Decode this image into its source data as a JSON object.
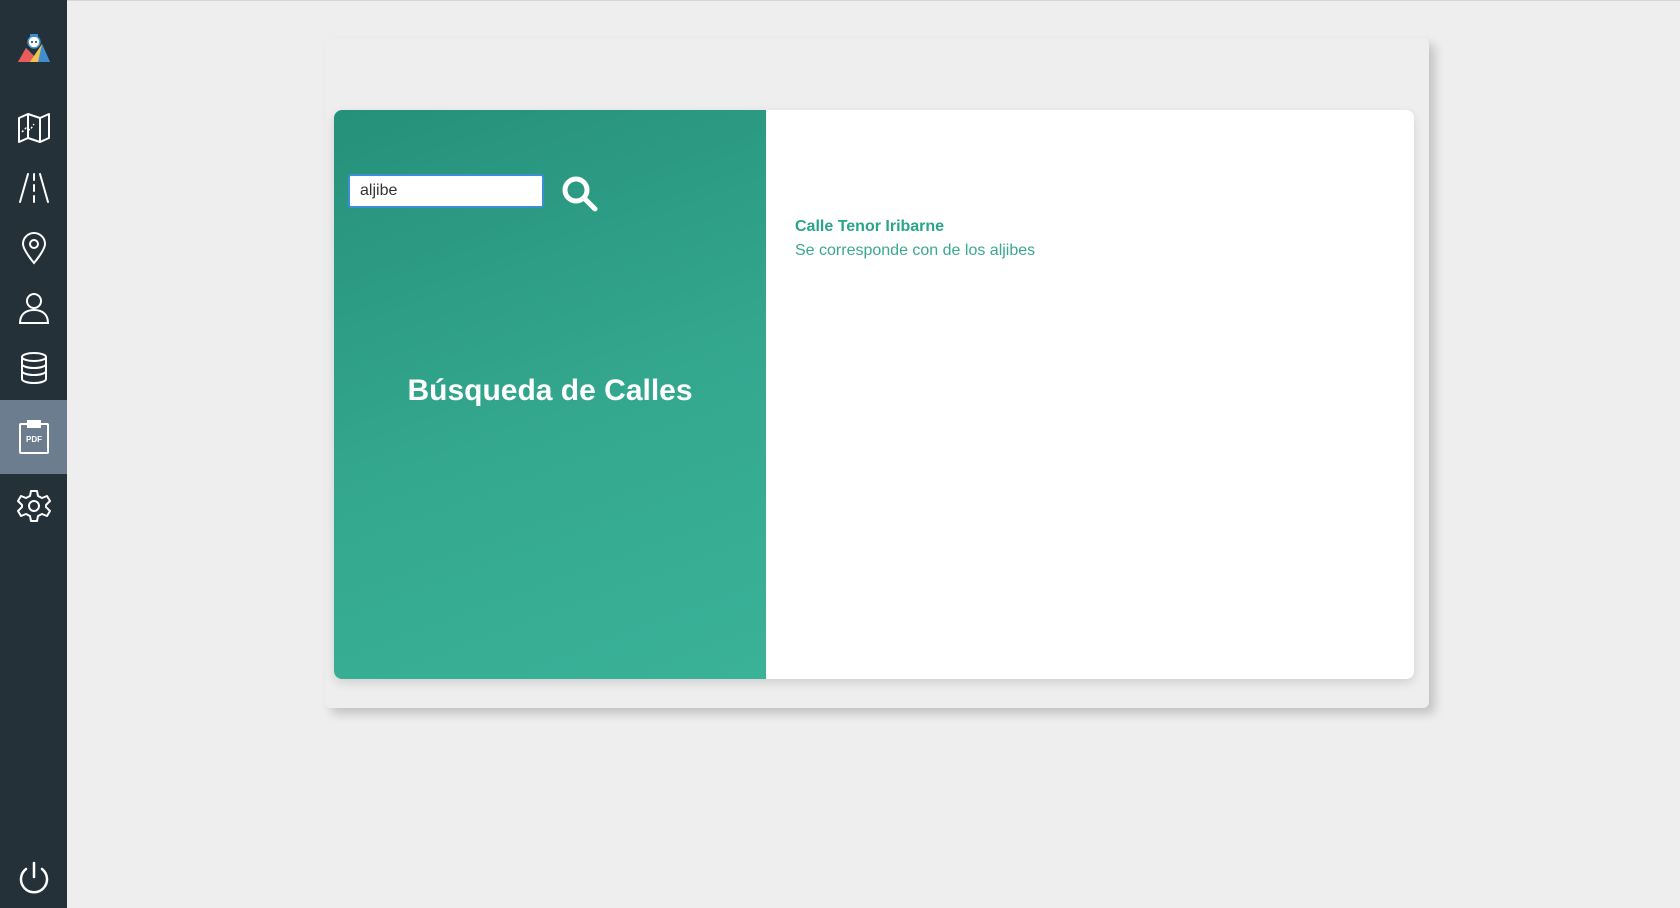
{
  "search": {
    "value": "aljibe",
    "placeholder": ""
  },
  "panel": {
    "title": "Búsqueda de Calles"
  },
  "results": [
    {
      "title": "Calle Tenor Iribarne",
      "description": "Se corresponde con de los aljibes"
    }
  ],
  "sidebar": {
    "items": [
      {
        "icon": "map-icon"
      },
      {
        "icon": "road-icon"
      },
      {
        "icon": "location-pin-icon"
      },
      {
        "icon": "user-icon"
      },
      {
        "icon": "database-icon"
      },
      {
        "icon": "pdf-clipboard-icon",
        "label": "PDF",
        "active": true
      },
      {
        "icon": "gear-icon"
      },
      {
        "icon": "power-icon"
      }
    ]
  },
  "colors": {
    "sidebar_bg": "#253139",
    "sidebar_active": "#6d7d90",
    "accent": "#2aa58a",
    "panel_gradient_start": "#26907a",
    "panel_gradient_end": "#3ab298"
  }
}
